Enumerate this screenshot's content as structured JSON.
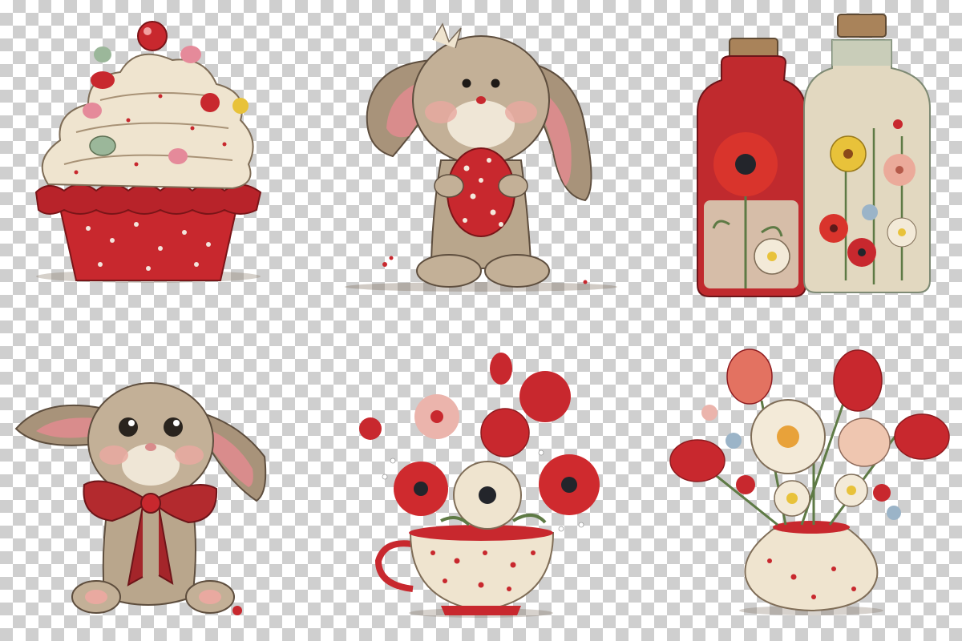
{
  "palette": {
    "red": "#c8282e",
    "dark_red": "#8e1b1f",
    "cream": "#efe4cf",
    "beige_fur": "#b9a68c",
    "pink": "#e9a9a0",
    "green": "#5e7a45",
    "yellow": "#e8c23a",
    "cork": "#a9835a",
    "glass": "#dfe3cf"
  },
  "illustrations": [
    {
      "subject": "cupcake",
      "icon": "cupcake-icon"
    },
    {
      "subject": "bunny-with-egg",
      "icon": "bunny-egg-icon"
    },
    {
      "subject": "flower-jars",
      "icon": "jars-icon"
    },
    {
      "subject": "bunny-with-bow",
      "icon": "bunny-bow-icon"
    },
    {
      "subject": "teacup-bouquet",
      "icon": "teacup-flowers-icon"
    },
    {
      "subject": "vase-bouquet",
      "icon": "vase-flowers-icon"
    }
  ]
}
